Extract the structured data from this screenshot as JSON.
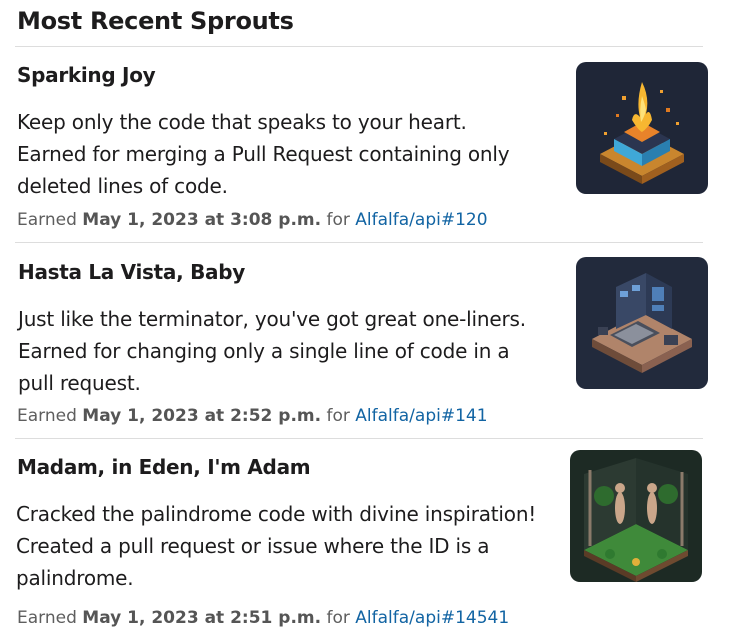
{
  "header": {
    "title": "Most Recent Sprouts"
  },
  "items": [
    {
      "title": "Sparking Joy",
      "desc_lines": [
        "Keep only the code that speaks to your heart.",
        "Earned for merging a Pull Request containing only",
        "deleted lines of code."
      ],
      "earned_prefix": "Earned",
      "date": "May 1, 2023 at 3:08 p.m.",
      "for_text": "for",
      "link": "Alfalfa/api#120",
      "image_icon": "burning-cube-illustration"
    },
    {
      "title": "Hasta La Vista, Baby",
      "desc_lines": [
        "Just like the terminator, you've got great one-liners.",
        "Earned for changing only a single line of code in a",
        "pull request."
      ],
      "earned_prefix": "Earned",
      "date": "May 1, 2023 at 2:52 p.m.",
      "for_text": "for",
      "link": "Alfalfa/api#141",
      "image_icon": "isometric-computer-illustration"
    },
    {
      "title": "Madam, in Eden, I'm Adam",
      "desc_lines": [
        "Cracked the palindrome code with divine inspiration!",
        "Created a pull request or issue where the ID is a",
        "palindrome."
      ],
      "earned_prefix": "Earned",
      "date": "May 1, 2023 at 2:51 p.m.",
      "for_text": "for",
      "link": "Alfalfa/api#14541",
      "image_icon": "garden-of-eden-illustration"
    }
  ]
}
